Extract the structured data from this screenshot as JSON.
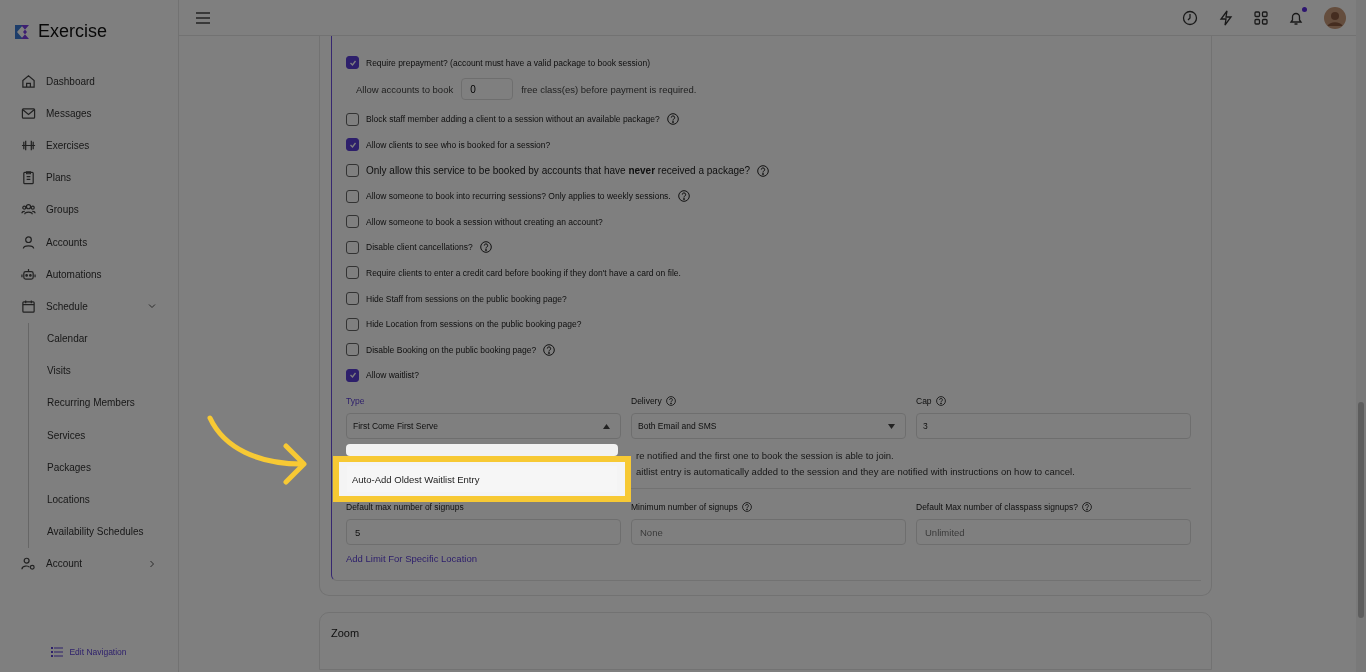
{
  "app": {
    "name": "Exercise"
  },
  "sidebar": {
    "items": [
      {
        "kind": "link",
        "label": "Dashboard"
      },
      {
        "kind": "link",
        "label": "Messages"
      },
      {
        "kind": "link",
        "label": "Exercises"
      },
      {
        "kind": "link",
        "label": "Plans"
      },
      {
        "kind": "link",
        "label": "Groups"
      },
      {
        "kind": "link",
        "label": "Accounts"
      },
      {
        "kind": "link",
        "label": "Automations"
      },
      {
        "kind": "group",
        "label": "Schedule",
        "expanded": true,
        "children": [
          {
            "label": "Calendar"
          },
          {
            "label": "Visits"
          },
          {
            "label": "Recurring Members"
          },
          {
            "label": "Services"
          },
          {
            "label": "Packages"
          },
          {
            "label": "Locations"
          },
          {
            "label": "Availability Schedules"
          }
        ]
      },
      {
        "kind": "group",
        "label": "Account",
        "expanded": false
      }
    ],
    "footer_link": "Edit Navigation"
  },
  "topbar": {
    "notifications_unread": true
  },
  "options": [
    {
      "label": "Require prepayment? (account must have a valid package to book session)",
      "checked": true,
      "help": false,
      "large": false
    },
    {
      "kind": "free_classes",
      "prefix": "Allow accounts to book",
      "value": "0",
      "suffix": "free class(es) before payment is required."
    },
    {
      "label": "Block staff member adding a client to a session without an available package?",
      "checked": false,
      "help": true,
      "large": false
    },
    {
      "label": "Allow clients to see who is booked for a session?",
      "checked": true,
      "help": false,
      "large": false
    },
    {
      "label": "Only allow this service to be booked by accounts that have **never** received a package?",
      "checked": false,
      "help": true,
      "large": true
    },
    {
      "label": "Allow someone to book into recurring sessions? Only applies to weekly sessions.",
      "checked": false,
      "help": true,
      "large": false
    },
    {
      "label": "Allow someone to book a session without creating an account?",
      "checked": false,
      "help": false,
      "large": false
    },
    {
      "label": "Disable client cancellations?",
      "checked": false,
      "help": true,
      "large": false
    },
    {
      "label": "Require clients to enter a credit card before booking if they don't have a card on file.",
      "checked": false,
      "help": false,
      "large": false
    },
    {
      "label": "Hide Staff from sessions on the public booking page?",
      "checked": false,
      "help": false,
      "large": false
    },
    {
      "label": "Hide Location from sessions on the public booking page?",
      "checked": false,
      "help": false,
      "large": false
    },
    {
      "label": "Disable Booking on the public booking page?",
      "checked": false,
      "help": true,
      "large": false
    },
    {
      "label": "Allow waitlist?",
      "checked": true,
      "help": false,
      "large": false
    }
  ],
  "waitlist": {
    "fields": [
      {
        "label": "Type",
        "value": "First Come First Serve",
        "help": false,
        "kind": "select",
        "expanded": true
      },
      {
        "label": "Delivery",
        "value": "Both Email and SMS",
        "help": true,
        "kind": "select",
        "expanded": false
      },
      {
        "label": "Cap",
        "value": "3",
        "help": true,
        "kind": "input"
      }
    ],
    "menu_option": "Auto-Add Oldest Waitlist Entry",
    "descriptions": [
      "re notified and the first one to book the session is able to join.",
      "aitlist entry is automatically added to the session and they are notified with instructions on how to cancel."
    ]
  },
  "limits": {
    "fields": [
      {
        "label": "Default max number of signups",
        "value": "5",
        "help": false
      },
      {
        "label": "Minimum number of signups",
        "placeholder": "None",
        "help": true
      },
      {
        "label": "Default Max number of classpass signups?",
        "placeholder": "Unlimited",
        "help": true
      }
    ],
    "link": "Add Limit For Specific Location"
  },
  "next_section": {
    "title": "Zoom"
  }
}
